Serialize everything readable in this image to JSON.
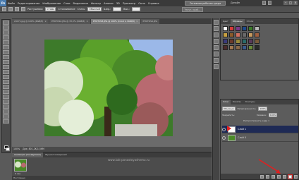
{
  "menu": {
    "logo": "Ps",
    "items": [
      "Файл",
      "Редактирование",
      "Изображение",
      "Слои",
      "Выделение",
      "Фильтр",
      "Анализ",
      "3D",
      "Просмотр",
      "Окно",
      "Справка"
    ],
    "workspace": "Основная рабочая среда",
    "design": "Дизайн"
  },
  "options": {
    "feather_label": "Растушевка:",
    "feather_value": "0 пикс",
    "smooth_label": "Сглаживание",
    "style_label": "Стиль:",
    "style_value": "Обычный",
    "width_label": "Шир.:",
    "height_label": "Выс.:",
    "refine_edge": "Уточн. край..."
  },
  "tabs": [
    {
      "label": "24171.jpg @ 100% (RGB/8)",
      "active": false
    },
    {
      "label": "PHOTOS2.JPG @ 33,3% (RGB/8)",
      "active": false
    },
    {
      "label": "PHOTOS3.JPG @ 100% (Слой 1, RGB/8)",
      "active": true
    },
    {
      "label": "PHOTOS4.JPG",
      "active": false
    }
  ],
  "status": {
    "zoom": "100%",
    "doc": "Док: 801,2K/1,56M"
  },
  "mini": {
    "tabs": [
      "Анимация (покадровая)",
      "Журнал измерений"
    ],
    "frame_label": "0 сек.",
    "watermark": "www.kak-ponastoyashemu.ru",
    "loop": "Постоянно"
  },
  "swatches": {
    "tabs": [
      "Цвет",
      "Образцы",
      "Стили"
    ],
    "colors": [
      "#ffffff",
      "#d33a3a",
      "#7a3a8a",
      "#1e4a8a",
      "#3a7a2a",
      "#b8b8b8",
      "#c8a040",
      "#8a5a2a",
      "#d07060",
      "#6a6a6a",
      "#c89a60",
      "#a06040",
      "#3a3a7a",
      "#6a3a2a",
      "#9a8a3a",
      "#2a6a6a",
      "#5a3a5a",
      "#7a5a3a",
      "#4a2a2a",
      "#a07850",
      "#8a6a4a",
      "#3a5a8a",
      "#6a8a3a",
      "#2a2a2a"
    ]
  },
  "layers": {
    "tabs": [
      "Слои",
      "Каналы",
      "Контуры"
    ],
    "mode": "Обычные",
    "opacity_label": "Непрозрачность:",
    "opacity_value": "100%",
    "lock_label": "Закрепить:",
    "fill_label": "Заливка:",
    "fill_value": "100%",
    "merge_label": "Распространить кадр 1",
    "items": [
      {
        "name": "Слой 1",
        "active": true
      },
      {
        "name": "Слой 0",
        "active": false
      }
    ]
  }
}
